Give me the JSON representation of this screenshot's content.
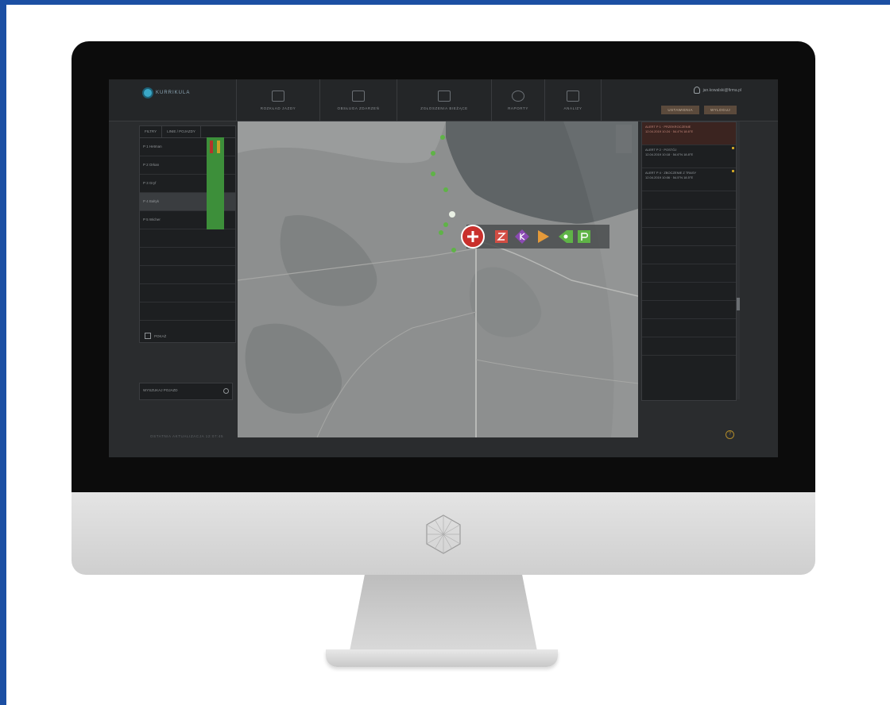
{
  "app": {
    "brand": "KURRIKULA"
  },
  "nav": {
    "items": [
      {
        "label": "ROZKŁAD JAZDY",
        "icon": "route-icon"
      },
      {
        "label": "OBSŁUGA ZDARZEŃ",
        "icon": "grid-icon"
      },
      {
        "label": "ZGŁOSZENIA BIEŻĄCE",
        "icon": "report-icon"
      },
      {
        "label": "RAPORTY",
        "icon": "globe-icon"
      },
      {
        "label": "ANALIZY",
        "icon": "chart-icon"
      }
    ]
  },
  "user": {
    "email": "jan.kowalski@firma.pl"
  },
  "top_buttons": [
    "USTAWIENIA",
    "WYLOGUJ"
  ],
  "left_panel": {
    "tabs": [
      "FILTRY",
      "LINIE / POJAZDY"
    ],
    "rows": [
      "P 1 Hetman",
      "P 2 Orkan",
      "P 3 Gryf",
      "P 4 Bałtyk",
      "P 5 Wicher"
    ],
    "footer": "POKAŻ"
  },
  "search": {
    "label": "WYSZUKAJ POJAZD"
  },
  "bottom_status": "OSTATNIA AKTUALIZACJA 12:07:45",
  "alerts": [
    {
      "title": "ALERT P 1 · PRZEKROCZENIE",
      "detail": "12.04.2019 10:24 · 54.4°N 18.6°E"
    },
    {
      "title": "ALERT P 2 · POSTÓJ",
      "detail": "12.04.2019 10:18 · 54.6°N 18.8°E"
    },
    {
      "title": "ALERT P 4 · ZBOCZENIE Z TRASY",
      "detail": "12.04.2019 10:06 · 54.5°N 18.5°E"
    }
  ],
  "help_icon": "?",
  "colors": {
    "accent": "#3aa7c7",
    "ok": "#3d8f3a",
    "alert": "#b6332a",
    "warning": "#c9a127"
  }
}
